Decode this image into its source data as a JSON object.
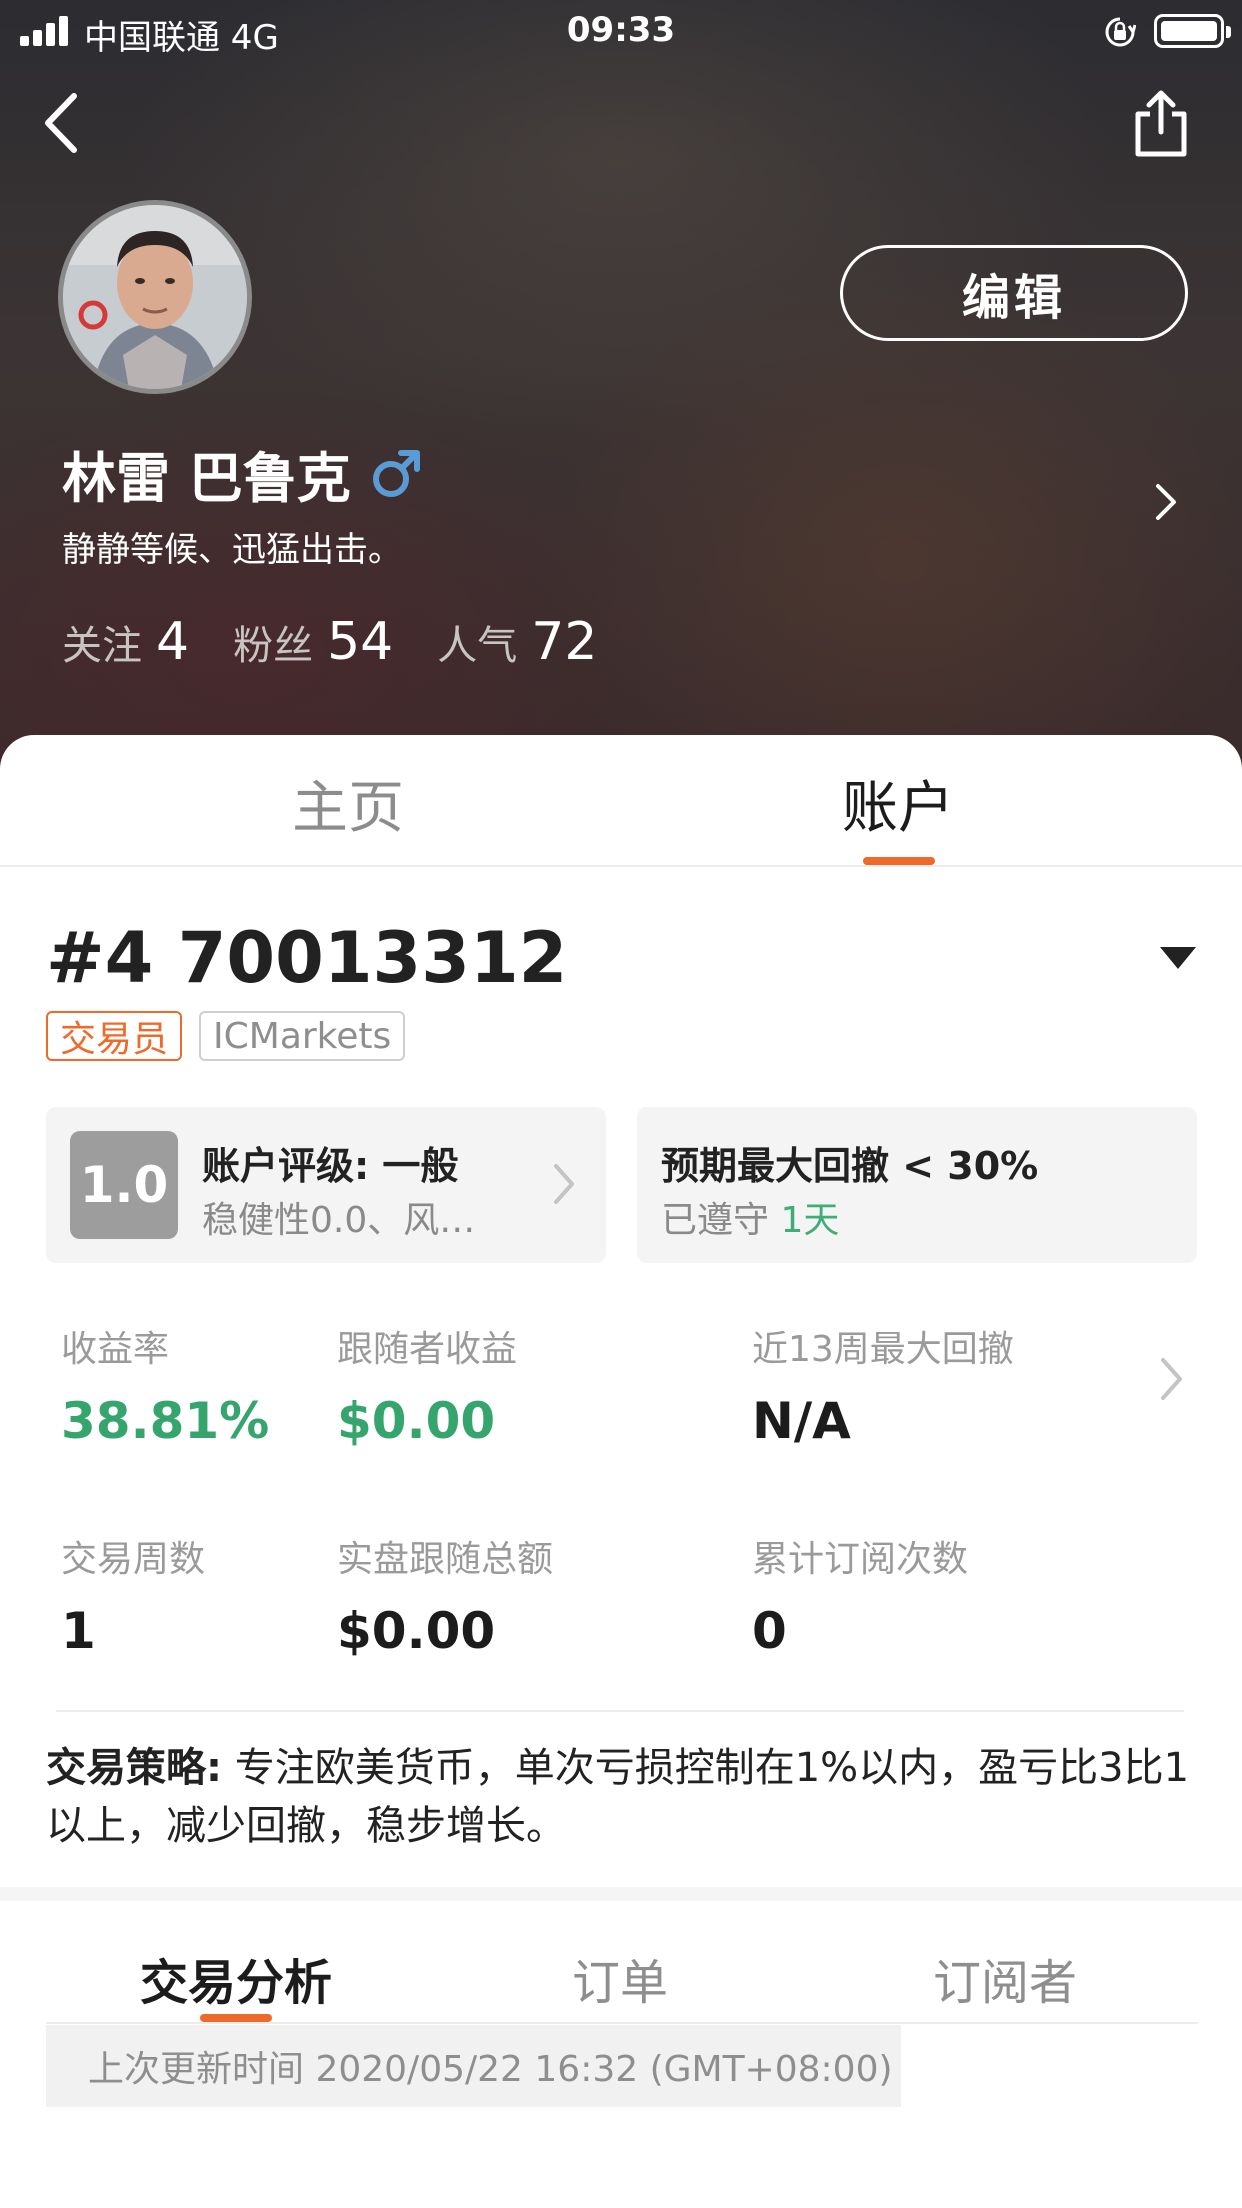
{
  "status_bar": {
    "carrier": "中国联通  4G",
    "time": "09:33"
  },
  "header": {
    "back_icon": "chevron-left-icon",
    "share_icon": "share-icon",
    "edit_label": "编辑",
    "name": "林雷 巴鲁克",
    "gender_icon": "male-icon",
    "bio": "静静等候、迅猛出击。",
    "stats": [
      {
        "label": "关注",
        "value": "4"
      },
      {
        "label": "粉丝",
        "value": "54"
      },
      {
        "label": "人气",
        "value": "72"
      }
    ]
  },
  "main_tabs": [
    {
      "label": "主页",
      "active": false
    },
    {
      "label": "账户",
      "active": true
    }
  ],
  "account": {
    "title": "#4 70013312",
    "tags": [
      "交易员",
      "ICMarkets"
    ],
    "rating": {
      "score": "1.0",
      "title": "账户评级: 一般",
      "subtitle": "稳健性0.0、风…"
    },
    "drawdown": {
      "title": "预期最大回撤 < 30%",
      "subtitle_prefix": "已遵守 ",
      "subtitle_value": "1天"
    },
    "metrics": [
      {
        "label": "收益率",
        "value": "38.81%"
      },
      {
        "label": "跟随者收益",
        "value": "$0.00"
      },
      {
        "label": "近13周最大回撤",
        "value": "N/A"
      },
      {
        "label": "交易周数",
        "value": "1"
      },
      {
        "label": "实盘跟随总额",
        "value": "$0.00"
      },
      {
        "label": "累计订阅次数",
        "value": "0"
      }
    ],
    "strategy_label": "交易策略:",
    "strategy_text": " 专注欧美货币，单次亏损控制在1%以内，盈亏比3比1以上，减少回撤，稳步增长。"
  },
  "sub_tabs": [
    {
      "label": "交易分析",
      "active": true
    },
    {
      "label": "订单",
      "active": false
    },
    {
      "label": "订阅者",
      "active": false
    }
  ],
  "update_time": "上次更新时间 2020/05/22 16:32 (GMT+08:00)",
  "colors": {
    "accent": "#ee6a2a",
    "positive": "#35a56d",
    "male_blue": "#5b9bd5"
  }
}
